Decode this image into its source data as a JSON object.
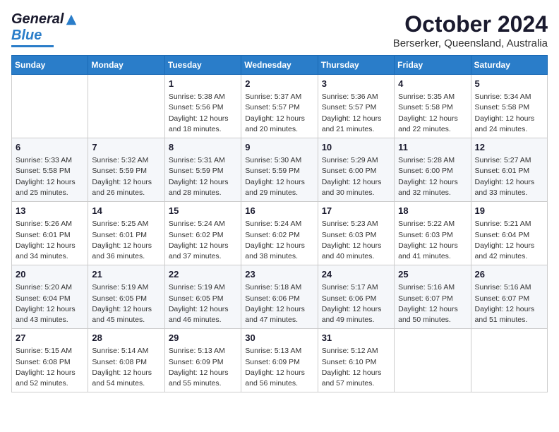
{
  "header": {
    "logo": {
      "general": "General",
      "blue": "Blue"
    },
    "title": "October 2024",
    "location": "Berserker, Queensland, Australia"
  },
  "days_of_week": [
    "Sunday",
    "Monday",
    "Tuesday",
    "Wednesday",
    "Thursday",
    "Friday",
    "Saturday"
  ],
  "weeks": [
    [
      {
        "day": "",
        "sunrise": "",
        "sunset": "",
        "daylight": ""
      },
      {
        "day": "",
        "sunrise": "",
        "sunset": "",
        "daylight": ""
      },
      {
        "day": "1",
        "sunrise": "Sunrise: 5:38 AM",
        "sunset": "Sunset: 5:56 PM",
        "daylight": "Daylight: 12 hours and 18 minutes."
      },
      {
        "day": "2",
        "sunrise": "Sunrise: 5:37 AM",
        "sunset": "Sunset: 5:57 PM",
        "daylight": "Daylight: 12 hours and 20 minutes."
      },
      {
        "day": "3",
        "sunrise": "Sunrise: 5:36 AM",
        "sunset": "Sunset: 5:57 PM",
        "daylight": "Daylight: 12 hours and 21 minutes."
      },
      {
        "day": "4",
        "sunrise": "Sunrise: 5:35 AM",
        "sunset": "Sunset: 5:58 PM",
        "daylight": "Daylight: 12 hours and 22 minutes."
      },
      {
        "day": "5",
        "sunrise": "Sunrise: 5:34 AM",
        "sunset": "Sunset: 5:58 PM",
        "daylight": "Daylight: 12 hours and 24 minutes."
      }
    ],
    [
      {
        "day": "6",
        "sunrise": "Sunrise: 5:33 AM",
        "sunset": "Sunset: 5:58 PM",
        "daylight": "Daylight: 12 hours and 25 minutes."
      },
      {
        "day": "7",
        "sunrise": "Sunrise: 5:32 AM",
        "sunset": "Sunset: 5:59 PM",
        "daylight": "Daylight: 12 hours and 26 minutes."
      },
      {
        "day": "8",
        "sunrise": "Sunrise: 5:31 AM",
        "sunset": "Sunset: 5:59 PM",
        "daylight": "Daylight: 12 hours and 28 minutes."
      },
      {
        "day": "9",
        "sunrise": "Sunrise: 5:30 AM",
        "sunset": "Sunset: 5:59 PM",
        "daylight": "Daylight: 12 hours and 29 minutes."
      },
      {
        "day": "10",
        "sunrise": "Sunrise: 5:29 AM",
        "sunset": "Sunset: 6:00 PM",
        "daylight": "Daylight: 12 hours and 30 minutes."
      },
      {
        "day": "11",
        "sunrise": "Sunrise: 5:28 AM",
        "sunset": "Sunset: 6:00 PM",
        "daylight": "Daylight: 12 hours and 32 minutes."
      },
      {
        "day": "12",
        "sunrise": "Sunrise: 5:27 AM",
        "sunset": "Sunset: 6:01 PM",
        "daylight": "Daylight: 12 hours and 33 minutes."
      }
    ],
    [
      {
        "day": "13",
        "sunrise": "Sunrise: 5:26 AM",
        "sunset": "Sunset: 6:01 PM",
        "daylight": "Daylight: 12 hours and 34 minutes."
      },
      {
        "day": "14",
        "sunrise": "Sunrise: 5:25 AM",
        "sunset": "Sunset: 6:01 PM",
        "daylight": "Daylight: 12 hours and 36 minutes."
      },
      {
        "day": "15",
        "sunrise": "Sunrise: 5:24 AM",
        "sunset": "Sunset: 6:02 PM",
        "daylight": "Daylight: 12 hours and 37 minutes."
      },
      {
        "day": "16",
        "sunrise": "Sunrise: 5:24 AM",
        "sunset": "Sunset: 6:02 PM",
        "daylight": "Daylight: 12 hours and 38 minutes."
      },
      {
        "day": "17",
        "sunrise": "Sunrise: 5:23 AM",
        "sunset": "Sunset: 6:03 PM",
        "daylight": "Daylight: 12 hours and 40 minutes."
      },
      {
        "day": "18",
        "sunrise": "Sunrise: 5:22 AM",
        "sunset": "Sunset: 6:03 PM",
        "daylight": "Daylight: 12 hours and 41 minutes."
      },
      {
        "day": "19",
        "sunrise": "Sunrise: 5:21 AM",
        "sunset": "Sunset: 6:04 PM",
        "daylight": "Daylight: 12 hours and 42 minutes."
      }
    ],
    [
      {
        "day": "20",
        "sunrise": "Sunrise: 5:20 AM",
        "sunset": "Sunset: 6:04 PM",
        "daylight": "Daylight: 12 hours and 43 minutes."
      },
      {
        "day": "21",
        "sunrise": "Sunrise: 5:19 AM",
        "sunset": "Sunset: 6:05 PM",
        "daylight": "Daylight: 12 hours and 45 minutes."
      },
      {
        "day": "22",
        "sunrise": "Sunrise: 5:19 AM",
        "sunset": "Sunset: 6:05 PM",
        "daylight": "Daylight: 12 hours and 46 minutes."
      },
      {
        "day": "23",
        "sunrise": "Sunrise: 5:18 AM",
        "sunset": "Sunset: 6:06 PM",
        "daylight": "Daylight: 12 hours and 47 minutes."
      },
      {
        "day": "24",
        "sunrise": "Sunrise: 5:17 AM",
        "sunset": "Sunset: 6:06 PM",
        "daylight": "Daylight: 12 hours and 49 minutes."
      },
      {
        "day": "25",
        "sunrise": "Sunrise: 5:16 AM",
        "sunset": "Sunset: 6:07 PM",
        "daylight": "Daylight: 12 hours and 50 minutes."
      },
      {
        "day": "26",
        "sunrise": "Sunrise: 5:16 AM",
        "sunset": "Sunset: 6:07 PM",
        "daylight": "Daylight: 12 hours and 51 minutes."
      }
    ],
    [
      {
        "day": "27",
        "sunrise": "Sunrise: 5:15 AM",
        "sunset": "Sunset: 6:08 PM",
        "daylight": "Daylight: 12 hours and 52 minutes."
      },
      {
        "day": "28",
        "sunrise": "Sunrise: 5:14 AM",
        "sunset": "Sunset: 6:08 PM",
        "daylight": "Daylight: 12 hours and 54 minutes."
      },
      {
        "day": "29",
        "sunrise": "Sunrise: 5:13 AM",
        "sunset": "Sunset: 6:09 PM",
        "daylight": "Daylight: 12 hours and 55 minutes."
      },
      {
        "day": "30",
        "sunrise": "Sunrise: 5:13 AM",
        "sunset": "Sunset: 6:09 PM",
        "daylight": "Daylight: 12 hours and 56 minutes."
      },
      {
        "day": "31",
        "sunrise": "Sunrise: 5:12 AM",
        "sunset": "Sunset: 6:10 PM",
        "daylight": "Daylight: 12 hours and 57 minutes."
      },
      {
        "day": "",
        "sunrise": "",
        "sunset": "",
        "daylight": ""
      },
      {
        "day": "",
        "sunrise": "",
        "sunset": "",
        "daylight": ""
      }
    ]
  ]
}
